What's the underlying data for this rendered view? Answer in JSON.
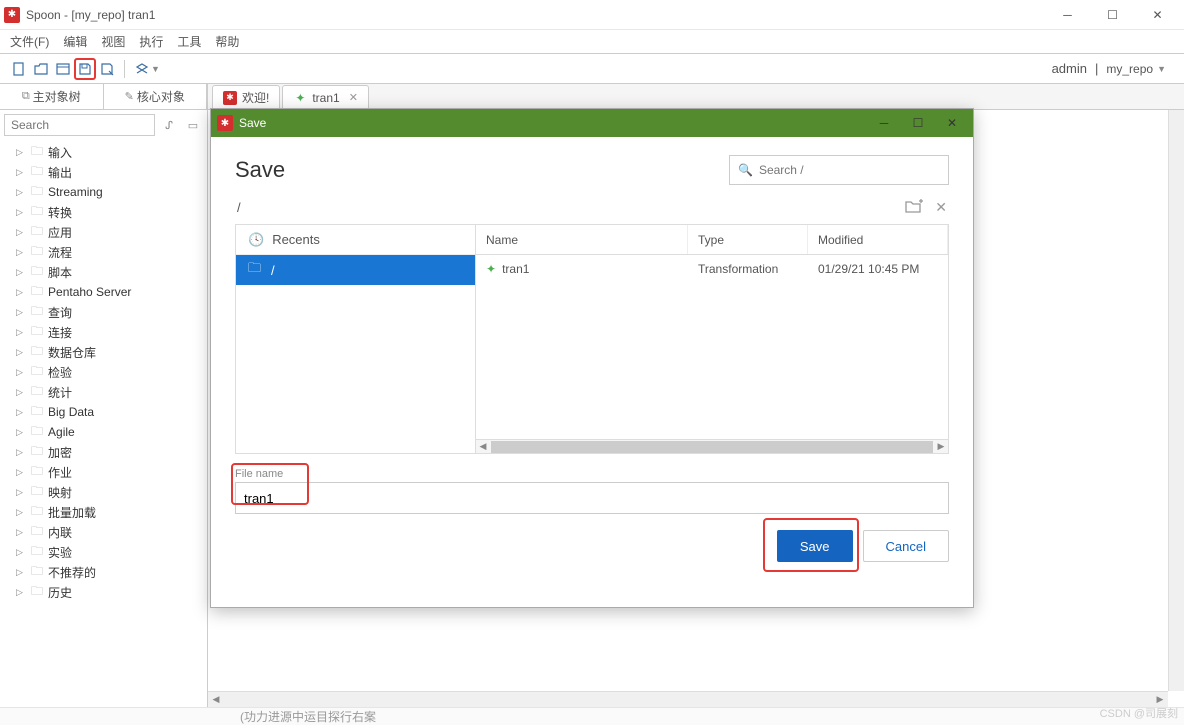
{
  "window": {
    "title": "Spoon - [my_repo] tran1",
    "min_tooltip": "Minimize",
    "max_tooltip": "Maximize",
    "close_tooltip": "Close"
  },
  "menubar": [
    "文件(F)",
    "编辑",
    "视图",
    "执行",
    "工具",
    "帮助"
  ],
  "toolbar": {
    "user_label": "admin",
    "repo_label": "my_repo",
    "separator": "|"
  },
  "sidebar": {
    "tabs": [
      "主对象树",
      "核心对象"
    ],
    "search_placeholder": "Search",
    "tree": [
      "输入",
      "输出",
      "Streaming",
      "转换",
      "应用",
      "流程",
      "脚本",
      "Pentaho Server",
      "查询",
      "连接",
      "数据仓库",
      "检验",
      "统计",
      "Big Data",
      "Agile",
      "加密",
      "作业",
      "映射",
      "批量加载",
      "内联",
      "实验",
      "不推荐的",
      "历史"
    ]
  },
  "content_tabs": [
    {
      "label": "欢迎!",
      "icon_kind": "red"
    },
    {
      "label": "tran1",
      "icon_kind": "green",
      "closable": true
    }
  ],
  "save_dialog": {
    "titlebar": "Save",
    "heading": "Save",
    "search_placeholder": "Search /",
    "breadcrumb": "/",
    "recents_label": "Recents",
    "root_label": "/",
    "columns": {
      "name": "Name",
      "type": "Type",
      "modified": "Modified"
    },
    "files": [
      {
        "name": "tran1",
        "type": "Transformation",
        "modified": "01/29/21 10:45 PM"
      }
    ],
    "filename_label": "File name",
    "filename_value": "tran1",
    "save_btn": "Save",
    "cancel_btn": "Cancel"
  },
  "bottom_text": "(功力进源中运目探行右案",
  "watermark": "CSDN @司展刻"
}
